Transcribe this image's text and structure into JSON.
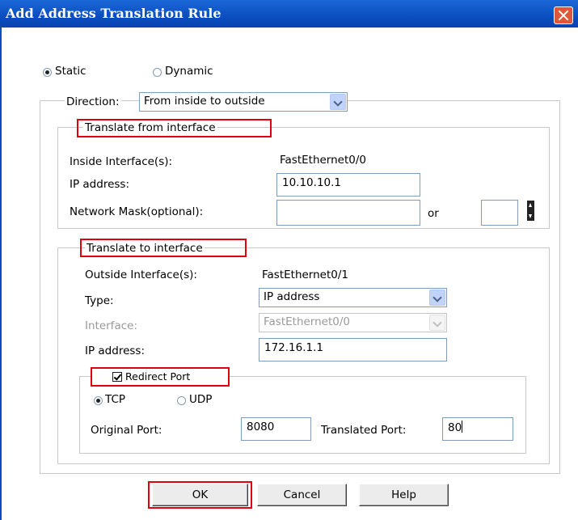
{
  "window": {
    "title": "Add Address Translation Rule"
  },
  "mode": {
    "static_label": "Static",
    "dynamic_label": "Dynamic",
    "selected": "Static"
  },
  "direction": {
    "label": "Direction:",
    "value": "From inside to outside"
  },
  "from": {
    "legend": "Translate from interface",
    "inside_label": "Inside Interface(s):",
    "inside_value": "FastEthernet0/0",
    "ip_label": "IP address:",
    "ip_value": "10.10.10.1",
    "mask_label": "Network Mask(optional):",
    "mask_value": "",
    "or_label": "or",
    "bits_value": ""
  },
  "to": {
    "legend": "Translate to interface",
    "outside_label": "Outside Interface(s):",
    "outside_value": "FastEthernet0/1",
    "type_label": "Type:",
    "type_value": "IP address",
    "interface_label": "Interface:",
    "interface_value": "FastEthernet0/0",
    "ip_label": "IP address:",
    "ip_value": "172.16.1.1"
  },
  "redirect": {
    "label": "Redirect Port",
    "checked": true,
    "tcp_label": "TCP",
    "udp_label": "UDP",
    "protocol": "TCP",
    "original_label": "Original Port:",
    "original_value": "8080",
    "translated_label": "Translated Port:",
    "translated_value": "80"
  },
  "buttons": {
    "ok": "OK",
    "cancel": "Cancel",
    "help": "Help"
  },
  "colors": {
    "titlebar": "#0a4ec0",
    "highlight": "#e0000f",
    "close": "#e0563a"
  }
}
